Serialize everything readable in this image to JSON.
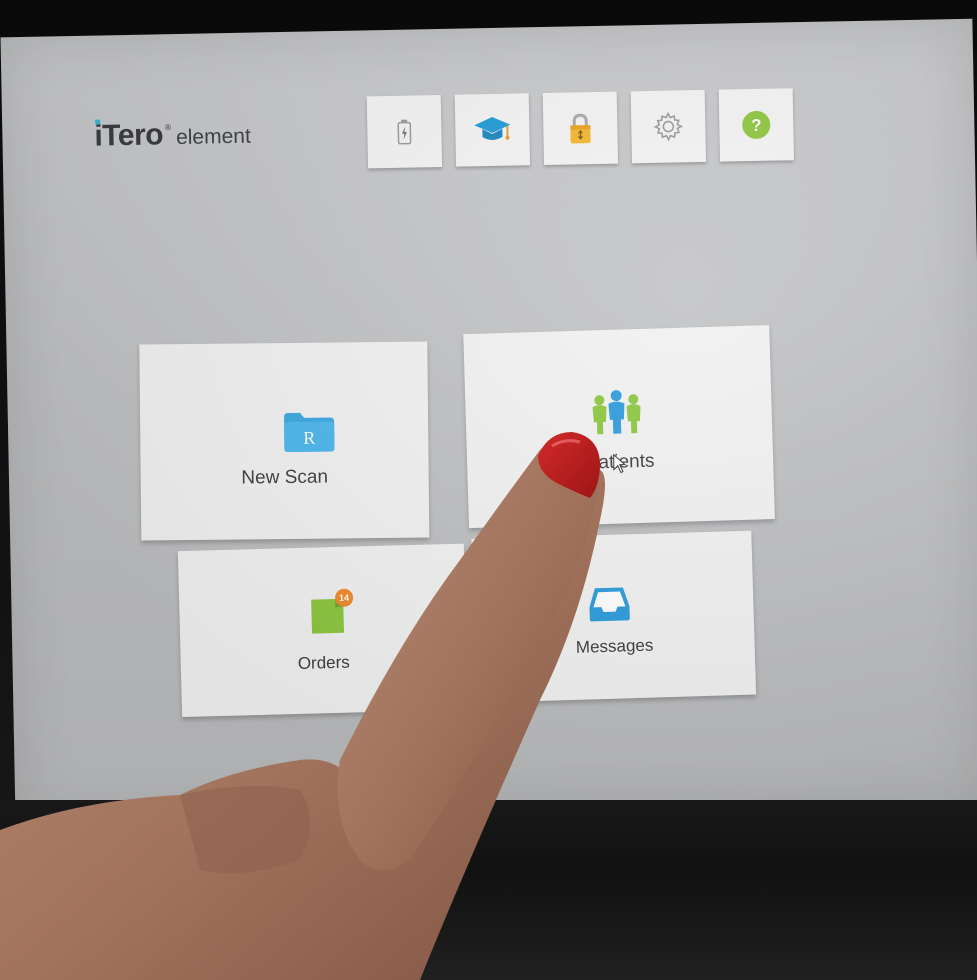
{
  "app": {
    "brand": "iTero",
    "brand_suffix": "element",
    "registered": "®"
  },
  "toolbar": {
    "buttons": [
      {
        "id": "battery",
        "icon": "battery-charging-icon"
      },
      {
        "id": "learning",
        "icon": "graduation-cap-icon"
      },
      {
        "id": "lock",
        "icon": "padlock-icon"
      },
      {
        "id": "settings",
        "icon": "gear-icon"
      },
      {
        "id": "help",
        "icon": "help-icon",
        "glyph": "?"
      }
    ]
  },
  "tiles": {
    "new_scan": {
      "label": "New Scan",
      "icon": "rx-folder-icon",
      "glyph": "R"
    },
    "patients": {
      "label": "Patients",
      "icon": "patients-group-icon"
    },
    "orders": {
      "label": "Orders",
      "icon": "orders-document-icon",
      "badge": "14"
    },
    "messages": {
      "label": "Messages",
      "icon": "inbox-tray-icon"
    }
  },
  "colors": {
    "accent_blue": "#3aa7e0",
    "accent_green": "#8cc63f",
    "badge_orange": "#f08a2c",
    "screen_bg": "#c4c5c7",
    "tile_bg": "#f1f1f1"
  }
}
